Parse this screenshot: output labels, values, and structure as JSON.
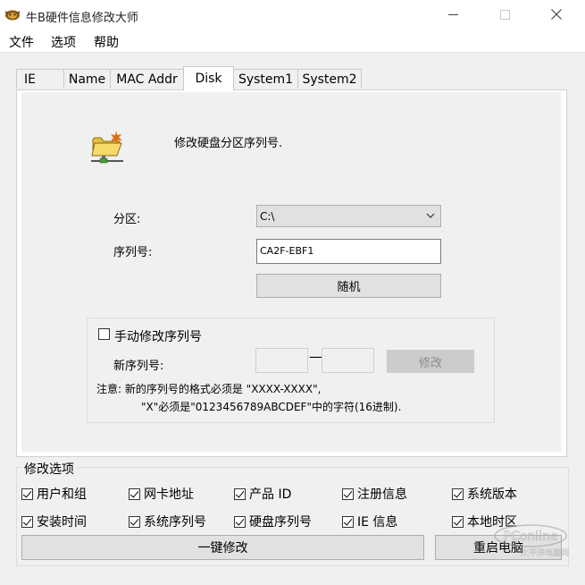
{
  "window": {
    "title": "牛B硬件信息修改大师",
    "minimize_icon": "minimize-icon",
    "maximize_icon": "maximize-icon",
    "close_icon": "close-icon",
    "close_symbol": "✕"
  },
  "menu": {
    "items": [
      "文件",
      "选项",
      "帮助"
    ]
  },
  "tabs": [
    {
      "label": "IE"
    },
    {
      "label": "Name"
    },
    {
      "label": "MAC Addr"
    },
    {
      "label": "Disk",
      "active": true
    },
    {
      "label": "System1"
    },
    {
      "label": "System2"
    }
  ],
  "disk": {
    "heading": "修改硬盘分区序列号.",
    "partition_label": "分区:",
    "partition_value": "C:\\",
    "serial_label": "序列号:",
    "serial_value": "CA2F-EBF1",
    "random_label": "随机",
    "manual": {
      "checkbox_label": "手动修改序列号",
      "checked": false,
      "new_serial_label": "新序列号:",
      "dash": "—",
      "part1_value": "",
      "part2_value": "",
      "modify_label": "修改"
    },
    "note_line1": "注意: 新的序列号的格式必须是 \"XXXX-XXXX\",",
    "note_line2": "\"X\"必须是\"0123456789ABCDEF\"中的字符(16进制)."
  },
  "options": {
    "legend": "修改选项",
    "items": [
      {
        "label": "用户和组",
        "checked": true
      },
      {
        "label": "网卡地址",
        "checked": true
      },
      {
        "label": "产品 ID",
        "checked": true
      },
      {
        "label": "注册信息",
        "checked": true
      },
      {
        "label": "系统版本",
        "checked": true
      },
      {
        "label": "安装时间",
        "checked": true
      },
      {
        "label": "系统序列号",
        "checked": true
      },
      {
        "label": "硬盘序列号",
        "checked": true
      },
      {
        "label": "IE 信息",
        "checked": true
      },
      {
        "label": "本地时区",
        "checked": true
      }
    ],
    "apply_label": "一键修改",
    "reboot_label": "重启电脑"
  },
  "watermark": {
    "text": "PConline",
    "sub": "太平洋电脑网"
  },
  "colors": {
    "client_bg": "#f0f0f0",
    "button_bg": "#e1e1e1",
    "disabled_text": "#8a8a8a"
  }
}
